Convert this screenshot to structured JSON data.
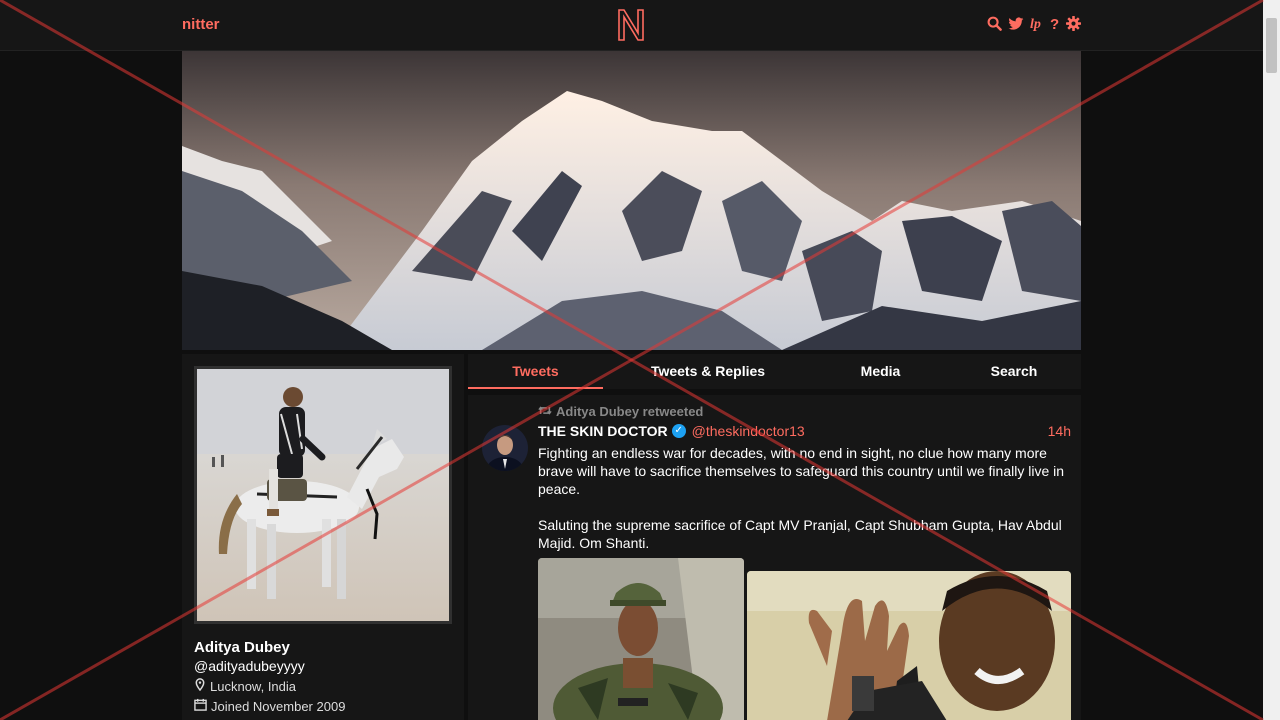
{
  "nav": {
    "brand": "nitter",
    "logo_letter": "N",
    "icons": [
      "search-icon",
      "twitter-bird-icon",
      "rss-icon",
      "info-icon",
      "gear-icon"
    ]
  },
  "profile": {
    "fullname": "Aditya Dubey",
    "username": "@adityadubeyyyy",
    "location": "Lucknow, India",
    "joined": "Joined November 2009"
  },
  "tabs": [
    {
      "label": "Tweets",
      "active": true
    },
    {
      "label": "Tweets & Replies",
      "active": false
    },
    {
      "label": "Media",
      "active": false
    },
    {
      "label": "Search",
      "active": false
    }
  ],
  "tweet": {
    "retweet_label": "Aditya Dubey retweeted",
    "fullname": "THE SKIN DOCTOR",
    "verified": true,
    "handle": "@theskindoctor13",
    "time": "14h",
    "text": "Fighting an endless war for decades, with no end in sight, no clue how many more brave will have to sacrifice themselves to safeguard this country until we finally live in peace.\n\nSaluting the supreme sacrifice of Capt MV Pranjal, Capt Shubham Gupta, Hav Abdul Majid. Om Shanti."
  },
  "colors": {
    "accent": "#ff6c60",
    "background": "#0f0f0f",
    "panel": "#161616",
    "overlay_cross": "#e53935"
  }
}
